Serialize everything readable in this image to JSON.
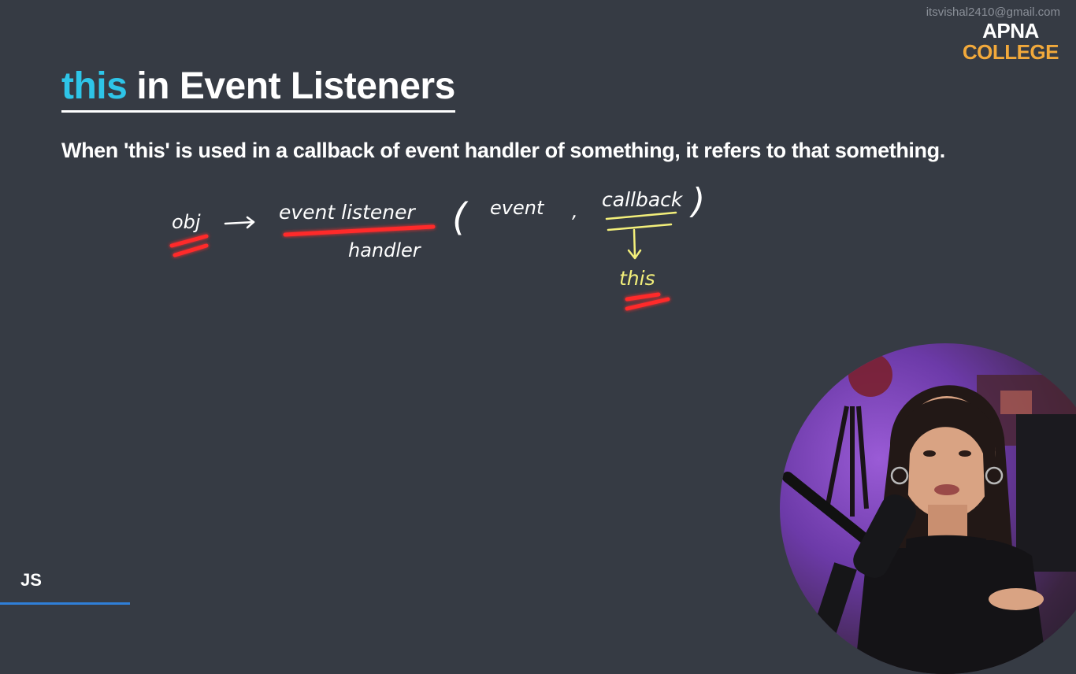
{
  "watermark": {
    "email": "itsvishal2410@gmail.com"
  },
  "logo": {
    "line1": "APNA",
    "line2": "COLLEGE"
  },
  "slide": {
    "title_keyword": "this",
    "title_rest": "in Event Listeners",
    "subtitle": "When 'this' is used in a callback of event handler of something, it refers to that something."
  },
  "diagram": {
    "obj": "obj",
    "event_listener": "event listener",
    "handler": "handler",
    "open_paren": "(",
    "event": "event",
    "comma": ",",
    "callback": "callback",
    "close_paren": ")",
    "this": "this"
  },
  "footer": {
    "label": "JS"
  },
  "colors": {
    "background": "#363b44",
    "keyword": "#2ec5e8",
    "logo_accent": "#f2a93b",
    "highlight_red": "#ff2a2a",
    "highlight_yellow": "#f3ef7a"
  }
}
